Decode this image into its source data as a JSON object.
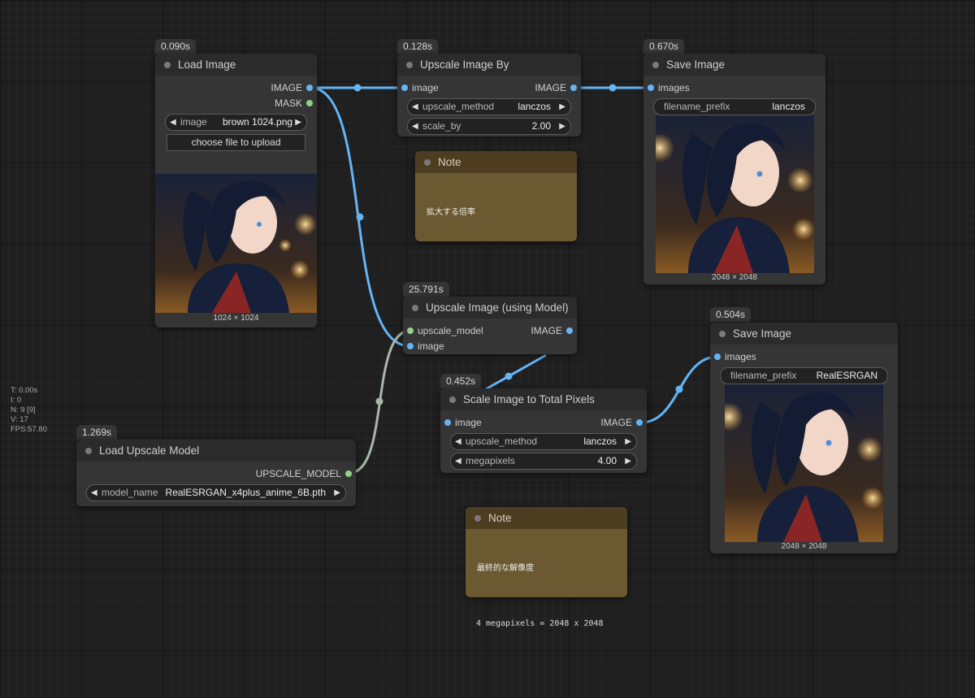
{
  "canvas": {
    "stats": [
      "T: 0.00s",
      "I: 0",
      "N: 9 [9]",
      "V: 17",
      "FPS:57.80"
    ],
    "footer_note": "4 megapixels = 2048 x 2048"
  },
  "nodes": {
    "load_image": {
      "timing": "0.090s",
      "title": "Load Image",
      "outputs": [
        "IMAGE",
        "MASK"
      ],
      "widget": {
        "name": "image",
        "value": "brown 1024.png"
      },
      "upload_label": "choose file to upload",
      "dims": "1024 × 1024"
    },
    "upscale_by": {
      "timing": "0.128s",
      "title": "Upscale Image By",
      "input": "image",
      "output": "IMAGE",
      "widgets": [
        {
          "name": "upscale_method",
          "value": "lanczos"
        },
        {
          "name": "scale_by",
          "value": "2.00"
        }
      ]
    },
    "save_image_1": {
      "timing": "0.670s",
      "title": "Save Image",
      "input": "images",
      "widget": {
        "name": "filename_prefix",
        "value": "lanczos"
      },
      "dims": "2048 × 2048"
    },
    "note_1": {
      "title": "Note",
      "text": "拡大する倍率"
    },
    "upscale_model": {
      "timing": "25.791s",
      "title": "Upscale Image (using Model)",
      "inputs": [
        "upscale_model",
        "image"
      ],
      "output": "IMAGE"
    },
    "save_image_2": {
      "timing": "0.504s",
      "title": "Save Image",
      "input": "images",
      "widget": {
        "name": "filename_prefix",
        "value": "RealESRGAN"
      },
      "dims": "2048 × 2048"
    },
    "scale_total": {
      "timing": "0.452s",
      "title": "Scale Image to Total Pixels",
      "input": "image",
      "output": "IMAGE",
      "widgets": [
        {
          "name": "upscale_method",
          "value": "lanczos"
        },
        {
          "name": "megapixels",
          "value": "4.00"
        }
      ]
    },
    "load_upscale_model": {
      "timing": "1.269s",
      "title": "Load Upscale Model",
      "output": "UPSCALE_MODEL",
      "widget": {
        "name": "model_name",
        "value": "RealESRGAN_x4plus_anime_6B.pth"
      }
    },
    "note_2": {
      "title": "Note",
      "text": "最終的な解像度"
    }
  },
  "colors": {
    "image_link": "#64b5f6",
    "model_link": "#8ed584",
    "note_bg": "#6b5a31"
  }
}
